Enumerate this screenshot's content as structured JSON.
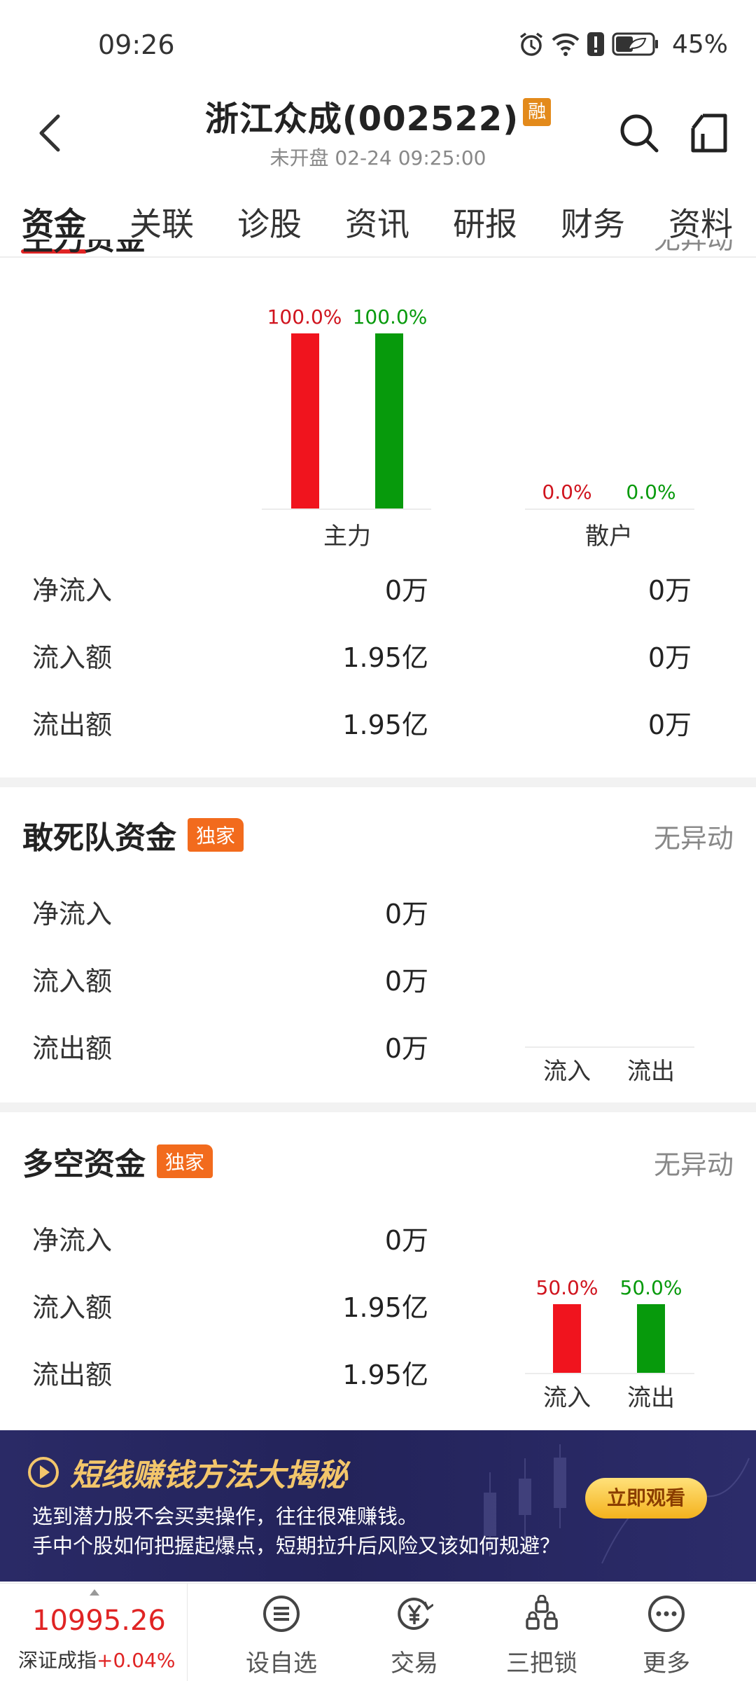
{
  "status_bar": {
    "time": "09:26",
    "battery": "45%"
  },
  "header": {
    "title": "浙江众成(002522)",
    "badge": "融",
    "subtitle": "未开盘 02-24 09:25:00"
  },
  "tabs": [
    {
      "label": "资金",
      "active": true
    },
    {
      "label": "关联"
    },
    {
      "label": "诊股"
    },
    {
      "label": "资讯"
    },
    {
      "label": "研报"
    },
    {
      "label": "财务"
    },
    {
      "label": "资料"
    }
  ],
  "section_main": {
    "partial_title": "主力资金",
    "partial_status": "无异动",
    "chart_data": {
      "type": "bar",
      "categories": [
        "主力",
        "散户"
      ],
      "series": [
        {
          "values": [
            100.0,
            0.0
          ]
        },
        {
          "values": [
            100.0,
            0.0
          ]
        }
      ],
      "value_labels": [
        [
          "100.0%",
          "100.0%"
        ],
        [
          "0.0%",
          "0.0%"
        ]
      ],
      "ylim": [
        0,
        100
      ]
    },
    "rows": [
      {
        "label": "净流入",
        "main": "0万",
        "retail": "0万"
      },
      {
        "label": "流入额",
        "main": "1.95亿",
        "retail": "0万"
      },
      {
        "label": "流出额",
        "main": "1.95亿",
        "retail": "0万"
      }
    ]
  },
  "section_dare": {
    "title": "敢死队资金",
    "badge": "独家",
    "status": "无异动",
    "rows": [
      {
        "label": "净流入",
        "value": "0万"
      },
      {
        "label": "流入额",
        "value": "0万"
      },
      {
        "label": "流出额",
        "value": "0万"
      }
    ],
    "chart_labels": [
      "流入",
      "流出"
    ]
  },
  "section_longshort": {
    "title": "多空资金",
    "badge": "独家",
    "status": "无异动",
    "rows": [
      {
        "label": "净流入",
        "value": "0万"
      },
      {
        "label": "流入额",
        "value": "1.95亿"
      },
      {
        "label": "流出额",
        "value": "1.95亿"
      }
    ],
    "chart_data": {
      "type": "bar",
      "categories": [
        "流入",
        "流出"
      ],
      "values": [
        50.0,
        50.0
      ],
      "value_labels": [
        "50.0%",
        "50.0%"
      ]
    }
  },
  "banner": {
    "title": "短线赚钱方法大揭秘",
    "line1": "选到潜力股不会买卖操作，往往很难赚钱。",
    "line2": "手中个股如何把握起爆点，短期拉升后风险又该如何规避？",
    "button": "立即观看"
  },
  "bottom_nav": {
    "index_value": "10995.26",
    "index_name": "深证成指",
    "index_change": "+0.04%",
    "items": [
      {
        "label": "设自选",
        "icon": "list-icon"
      },
      {
        "label": "交易",
        "icon": "yen-icon"
      },
      {
        "label": "三把锁",
        "icon": "locks-icon"
      },
      {
        "label": "更多",
        "icon": "more-icon"
      }
    ]
  },
  "colors": {
    "up": "#f0141e",
    "down": "#079a0c",
    "accent": "#e02424"
  }
}
